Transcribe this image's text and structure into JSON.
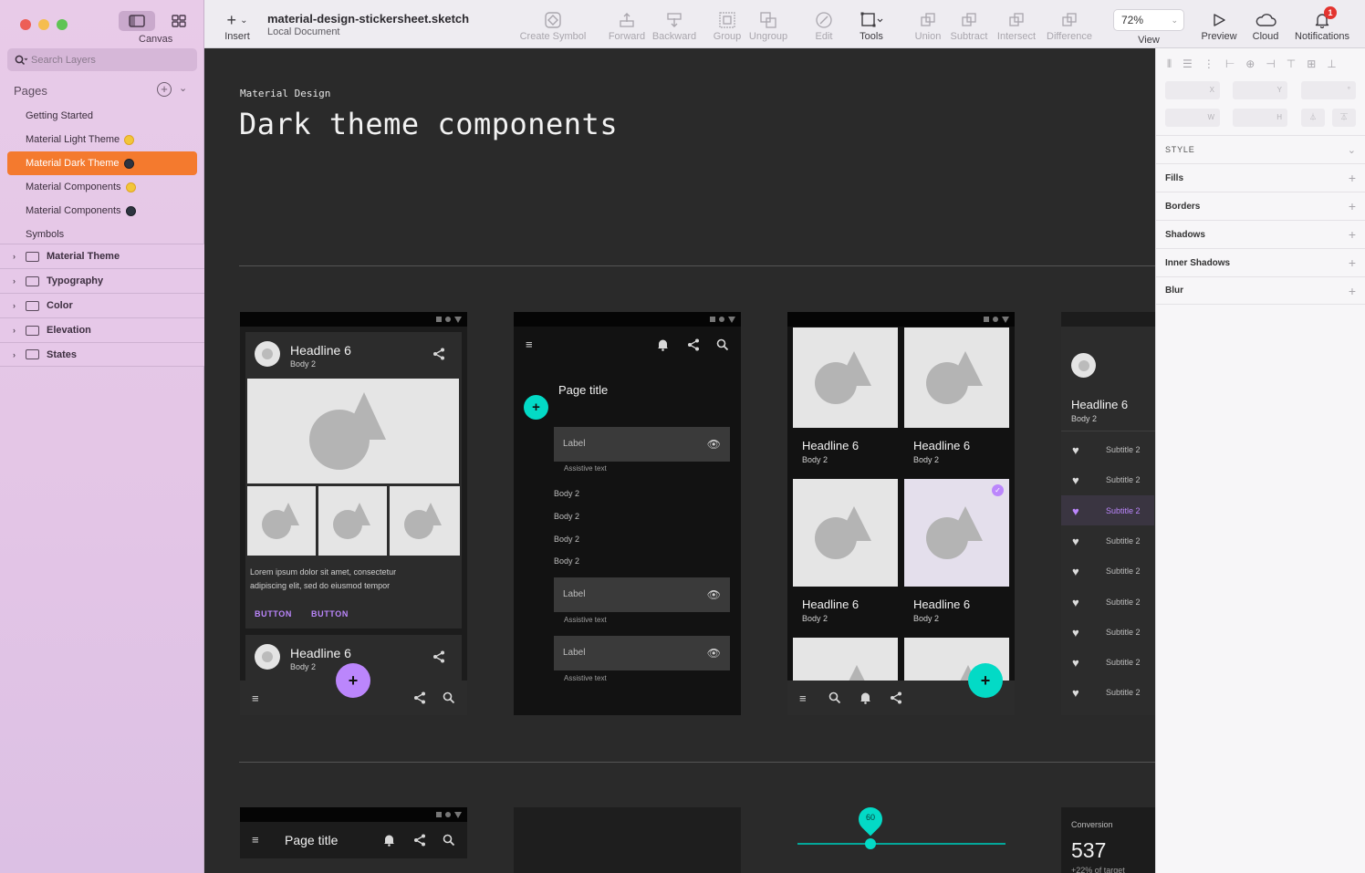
{
  "window": {
    "canvas_label": "Canvas",
    "search_placeholder": "Search Layers",
    "pages_header": "Pages"
  },
  "pages": [
    {
      "label": "Getting Started",
      "marker": ""
    },
    {
      "label": "Material Light Theme",
      "marker": "sun"
    },
    {
      "label": "Material Dark Theme",
      "marker": "moon",
      "active": true
    },
    {
      "label": "Material Components",
      "marker": "sun"
    },
    {
      "label": "Material Components",
      "marker": "moon"
    },
    {
      "label": "Symbols",
      "marker": ""
    }
  ],
  "layers": [
    "Material Theme",
    "Typography",
    "Color",
    "Elevation",
    "States"
  ],
  "toolbar": {
    "insert": "Insert",
    "doc_title": "material-design-stickersheet.sketch",
    "doc_sub": "Local Document",
    "create_symbol": "Create Symbol",
    "forward": "Forward",
    "backward": "Backward",
    "group": "Group",
    "ungroup": "Ungroup",
    "edit": "Edit",
    "tools": "Tools",
    "union": "Union",
    "subtract": "Subtract",
    "intersect": "Intersect",
    "difference": "Difference",
    "zoom": "72%",
    "view": "View",
    "preview": "Preview",
    "cloud": "Cloud",
    "notifications": "Notifications",
    "notif_count": "1"
  },
  "canvas": {
    "subtitle": "Material Design",
    "title": "Dark theme components",
    "card1": {
      "headline": "Headline 6",
      "body": "Body 2",
      "lorem1": "Lorem ipsum dolor sit amet, consectetur",
      "lorem2": "adipiscing elit, sed do eiusmod tempor",
      "button1": "BUTTON",
      "button2": "BUTTON",
      "headline2": "Headline 6",
      "body2": "Body 2"
    },
    "form": {
      "page_title": "Page title",
      "label1": "Label",
      "assist1": "Assistive text",
      "items": [
        "Body 2",
        "Body 2",
        "Body 2",
        "Body 2"
      ],
      "label2": "Label",
      "assist2": "Assistive text",
      "label3": "Label",
      "assist3": "Assistive text"
    },
    "grid": {
      "tiles": [
        {
          "headline": "Headline 6",
          "body": "Body 2"
        },
        {
          "headline": "Headline 6",
          "body": "Body 2"
        },
        {
          "headline": "Headline 6",
          "body": "Body 2"
        },
        {
          "headline": "Headline 6",
          "body": "Body 2"
        }
      ]
    },
    "drawer": {
      "headline": "Headline 6",
      "body": "Body 2",
      "items": [
        "Subtitle 2",
        "Subtitle 2",
        "Subtitle 2",
        "Subtitle 2",
        "Subtitle 2",
        "Subtitle 2",
        "Subtitle 2",
        "Subtitle 2",
        "Subtitle 2"
      ],
      "selected_index": 2
    },
    "appbar": {
      "title": "Page title"
    },
    "slider": {
      "value": "60"
    },
    "stat": {
      "label": "Conversion",
      "value": "537",
      "sub": "+22% of target"
    }
  },
  "inspector": {
    "x": "X",
    "y": "Y",
    "rot": "°",
    "w": "W",
    "h": "H",
    "style": "STYLE",
    "sections": [
      "Fills",
      "Borders",
      "Shadows",
      "Inner Shadows",
      "Blur"
    ]
  },
  "colors": {
    "accent_orange": "#f47a2e",
    "purple": "#bb86fc",
    "teal": "#03dac6"
  }
}
